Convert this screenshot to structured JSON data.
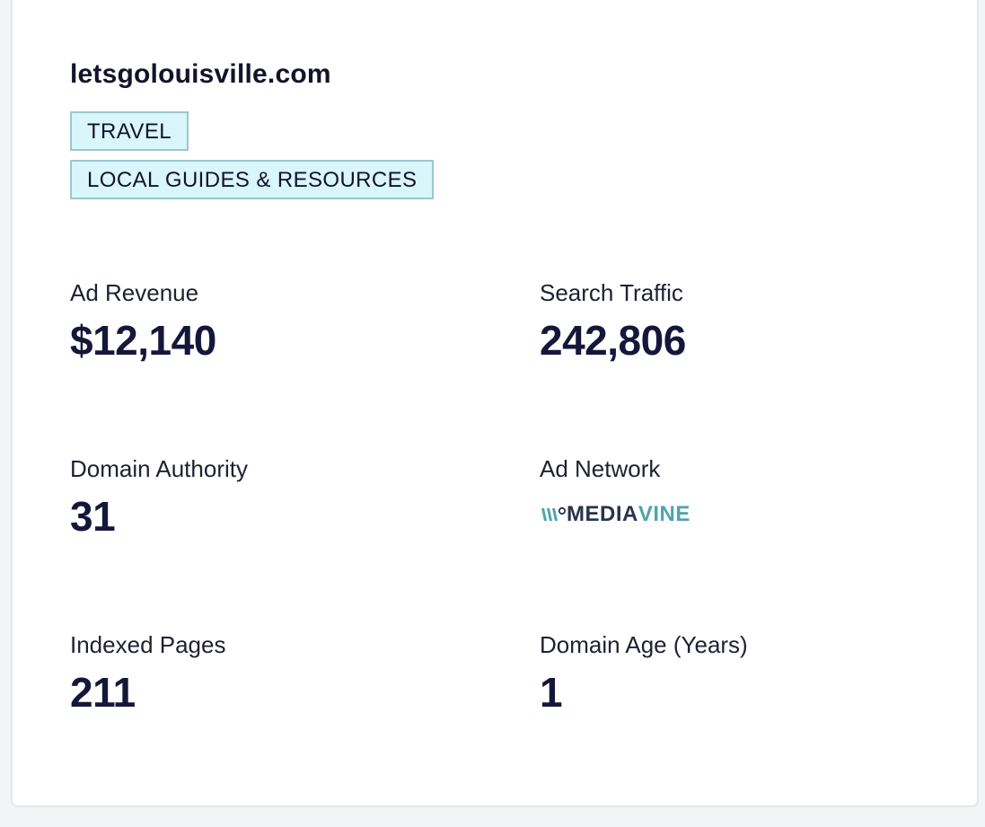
{
  "site": {
    "domain": "letsgolouisville.com",
    "tags": [
      "TRAVEL",
      "LOCAL GUIDES & RESOURCES"
    ]
  },
  "metrics": {
    "ad_revenue": {
      "label": "Ad Revenue",
      "value": "$12,140"
    },
    "search_traffic": {
      "label": "Search Traffic",
      "value": "242,806"
    },
    "domain_authority": {
      "label": "Domain Authority",
      "value": "31"
    },
    "ad_network": {
      "label": "Ad Network",
      "logo_part_1": "MEDIA",
      "logo_part_2": "VINE",
      "logo_icon": "mediavine-logo-icon"
    },
    "indexed_pages": {
      "label": "Indexed Pages",
      "value": "211"
    },
    "domain_age": {
      "label": "Domain Age (Years)",
      "value": "1"
    }
  },
  "colors": {
    "text_primary": "#15173a",
    "tag_background": "#d9f6fb",
    "tag_border": "#9cc6d1",
    "mediavine_dark": "#28334c",
    "mediavine_teal": "#4fa3ad"
  }
}
